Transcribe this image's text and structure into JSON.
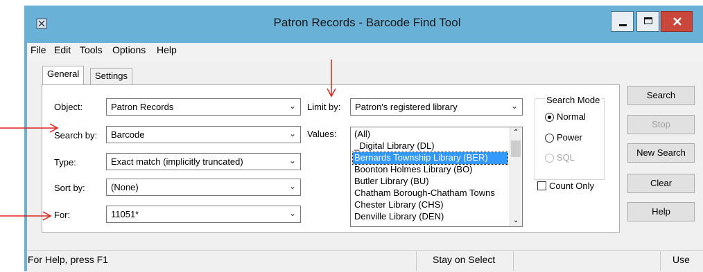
{
  "window": {
    "title": "Patron Records - Barcode Find Tool"
  },
  "menu": [
    "File",
    "Edit",
    "Tools",
    "Options",
    "Help"
  ],
  "tabs": [
    {
      "label": "General",
      "active": true
    },
    {
      "label": "Settings",
      "active": false
    }
  ],
  "fields": {
    "object": {
      "label": "Object:",
      "value": "Patron Records"
    },
    "search_by": {
      "label": "Search by:",
      "value": "Barcode"
    },
    "type": {
      "label": "Type:",
      "value": "Exact match (implicitly truncated)"
    },
    "sort_by": {
      "label": "Sort by:",
      "value": "(None)"
    },
    "for": {
      "label": "For:",
      "value": "11051*"
    },
    "limit_by": {
      "label": "Limit by:",
      "value": "Patron's registered library"
    },
    "values": {
      "label": "Values:"
    }
  },
  "values_list": [
    {
      "label": "(All)",
      "selected": false
    },
    {
      "label": "_Digital Library (DL)",
      "selected": false
    },
    {
      "label": "Bernards Township Library (BER)",
      "selected": true
    },
    {
      "label": "Boonton Holmes Library   (BO)",
      "selected": false
    },
    {
      "label": "Butler Library (BU)",
      "selected": false
    },
    {
      "label": "Chatham Borough-Chatham Towns",
      "selected": false
    },
    {
      "label": "Chester Library  (CHS)",
      "selected": false
    },
    {
      "label": "Denville Library (DEN)",
      "selected": false
    }
  ],
  "search_mode": {
    "title": "Search Mode",
    "options": [
      {
        "label": "Normal",
        "selected": true,
        "enabled": true
      },
      {
        "label": "Power",
        "selected": false,
        "enabled": true
      },
      {
        "label": "SQL",
        "selected": false,
        "enabled": false
      }
    ]
  },
  "count_only": {
    "label": "Count Only",
    "checked": false
  },
  "buttons": {
    "search": "Search",
    "stop": "Stop",
    "new_search": "New Search",
    "clear": "Clear",
    "help": "Help"
  },
  "status": {
    "help_text": "For Help, press F1",
    "mode_text": "Stay on Select",
    "right_text": "Use"
  },
  "colors": {
    "title_bar": "#6ab1d8",
    "selection": "#3399ff",
    "annotation_arrow": "#e0211b",
    "close_button": "#c9483b"
  }
}
